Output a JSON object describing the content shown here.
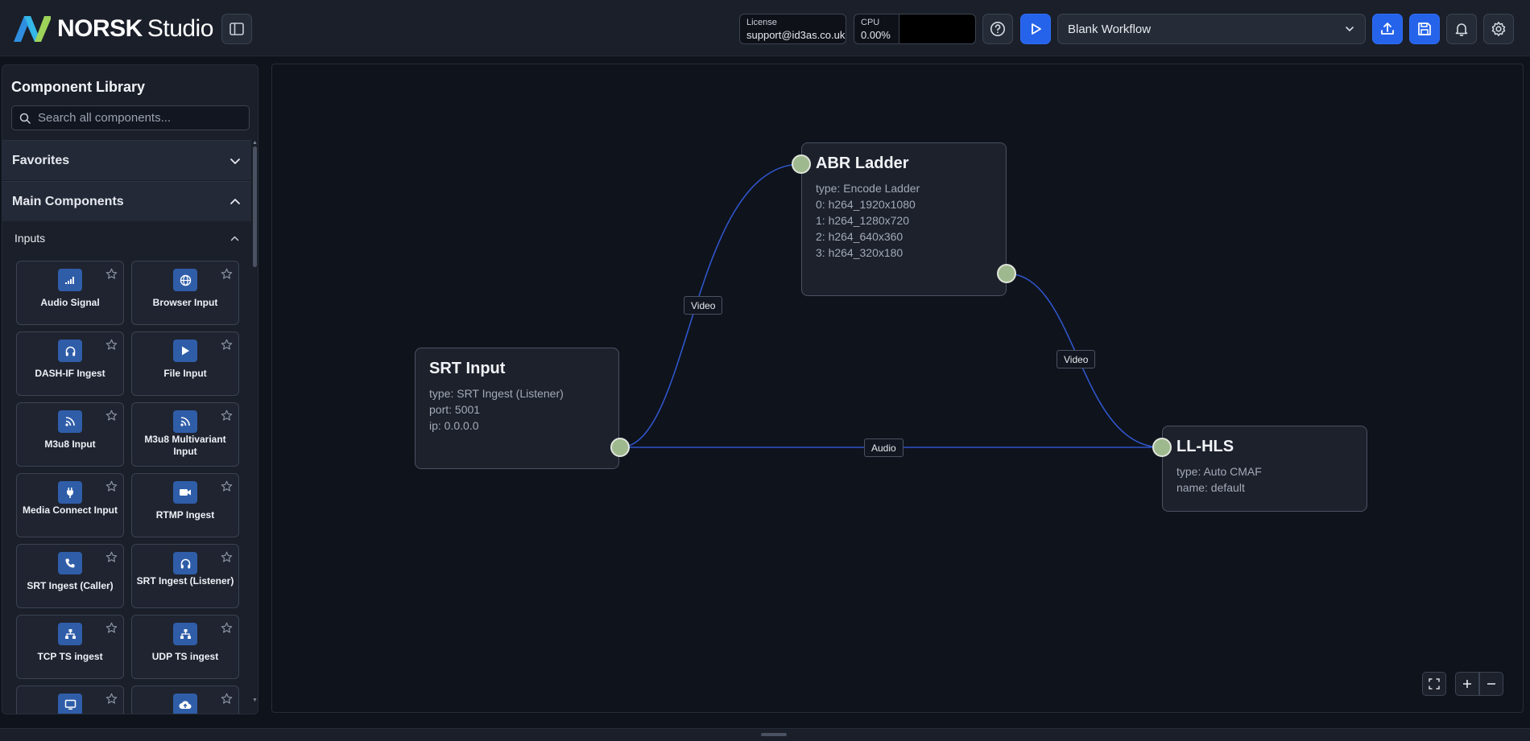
{
  "header": {
    "brand": "NORSK",
    "brand_suffix": "Studio",
    "license": {
      "label": "License",
      "value": "support@id3as.co.uk"
    },
    "cpu": {
      "label": "CPU",
      "value": "0.00%"
    },
    "workflow": "Blank Workflow",
    "icons": {
      "sidebar_toggle": "sidebar-panel-icon",
      "help": "question-circle-icon",
      "play": "play-icon",
      "upload": "upload-icon",
      "save": "save-icon",
      "bell": "bell-icon",
      "settings": "gear-icon"
    }
  },
  "sidebar": {
    "title": "Component Library",
    "search_placeholder": "Search all components...",
    "sections": {
      "favorites": "Favorites",
      "main": "Main Components",
      "inputs": "Inputs"
    },
    "components": [
      {
        "name": "Audio Signal",
        "icon": "signal-bars-icon"
      },
      {
        "name": "Browser Input",
        "icon": "globe-icon"
      },
      {
        "name": "DASH-IF Ingest",
        "icon": "headphones-icon"
      },
      {
        "name": "File Input",
        "icon": "play-icon"
      },
      {
        "name": "M3u8 Input",
        "icon": "rss-icon"
      },
      {
        "name": "M3u8 Multivariant Input",
        "icon": "rss-icon"
      },
      {
        "name": "Media Connect Input",
        "icon": "plug-icon"
      },
      {
        "name": "RTMP Ingest",
        "icon": "video-camera-icon"
      },
      {
        "name": "SRT Ingest (Caller)",
        "icon": "phone-icon"
      },
      {
        "name": "SRT Ingest (Listener)",
        "icon": "headphones-icon"
      },
      {
        "name": "TCP TS ingest",
        "icon": "network-icon"
      },
      {
        "name": "UDP TS ingest",
        "icon": "network-icon"
      },
      {
        "name": "",
        "icon": "monitor-icon"
      },
      {
        "name": "",
        "icon": "cloud-upload-icon"
      }
    ]
  },
  "canvas": {
    "nodes": {
      "srt": {
        "title": "SRT Input",
        "props": [
          "type: SRT Ingest (Listener)",
          "port: 5001",
          "ip: 0.0.0.0"
        ]
      },
      "abr": {
        "title": "ABR Ladder",
        "props": [
          "type: Encode Ladder",
          "0: h264_1920x1080",
          "1: h264_1280x720",
          "2: h264_640x360",
          "3: h264_320x180"
        ]
      },
      "hls": {
        "title": "LL-HLS",
        "props": [
          "type: Auto CMAF",
          "name: default"
        ]
      }
    },
    "edges": [
      {
        "from": "SRT Input",
        "to": "ABR Ladder",
        "label": "Video"
      },
      {
        "from": "ABR Ladder",
        "to": "LL-HLS",
        "label": "Video"
      },
      {
        "from": "SRT Input",
        "to": "LL-HLS",
        "label": "Audio"
      }
    ],
    "edge_color": "#2f55c9",
    "port_color": "#9fb98f"
  },
  "colors": {
    "accent": "#2563eb",
    "background": "#0f131c",
    "panel": "#1a1f29"
  }
}
